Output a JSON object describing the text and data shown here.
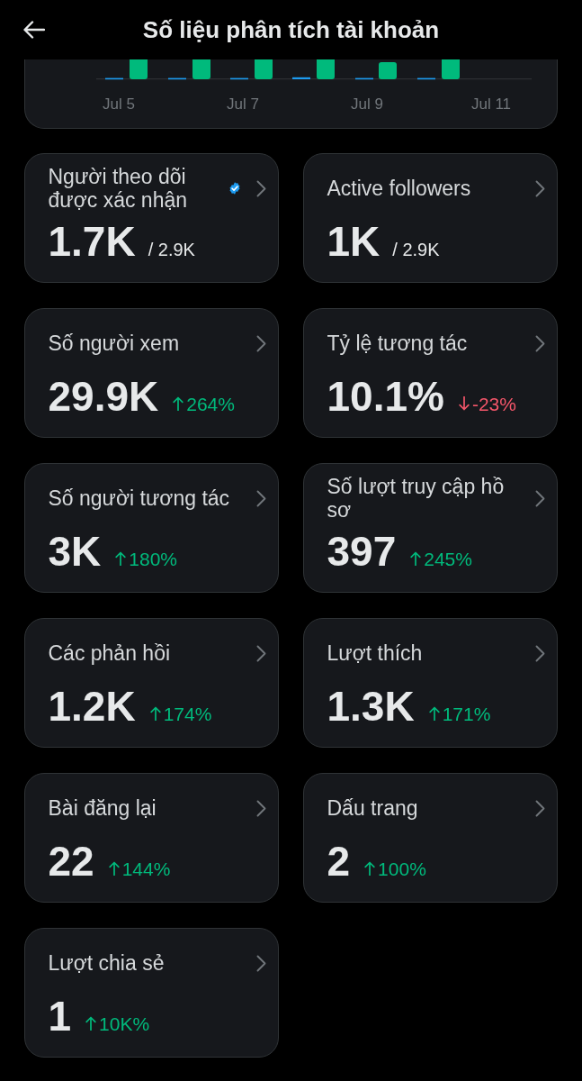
{
  "header": {
    "title": "Số liệu phân tích tài khoản"
  },
  "chart": {
    "x_labels": [
      "Jul 5",
      "Jul 7",
      "Jul 9",
      "Jul 11"
    ]
  },
  "metric_rows": [
    {
      "cards": [
        {
          "kind": "ratio",
          "label": "Người theo dõi được xác nhận",
          "verified": true,
          "value": "1.7K",
          "total": "/ 2.9K"
        },
        {
          "kind": "ratio",
          "label": "Active followers",
          "verified": false,
          "value": "1K",
          "total": "/ 2.9K"
        }
      ]
    },
    {
      "cards": [
        {
          "kind": "change",
          "label": "Số người xem",
          "verified": false,
          "value": "29.9K",
          "rising": true,
          "change": "264%"
        },
        {
          "kind": "change",
          "label": "Tỷ lệ tương tác",
          "verified": false,
          "value": "10.1%",
          "rising": false,
          "change": "-23%"
        }
      ]
    },
    {
      "cards": [
        {
          "kind": "change",
          "label": "Số người tương tác",
          "verified": false,
          "value": "3K",
          "rising": true,
          "change": "180%"
        },
        {
          "kind": "change",
          "label": "Số lượt truy cập hồ sơ",
          "verified": false,
          "value": "397",
          "rising": true,
          "change": "245%"
        }
      ]
    },
    {
      "cards": [
        {
          "kind": "change",
          "label": "Các phản hồi",
          "verified": false,
          "value": "1.2K",
          "rising": true,
          "change": "174%"
        },
        {
          "kind": "change",
          "label": "Lượt thích",
          "verified": false,
          "value": "1.3K",
          "rising": true,
          "change": "171%"
        }
      ]
    },
    {
      "cards": [
        {
          "kind": "change",
          "label": "Bài đăng lại",
          "verified": false,
          "value": "22",
          "rising": true,
          "change": "144%"
        },
        {
          "kind": "change",
          "label": "Dấu trang",
          "verified": false,
          "value": "2",
          "rising": true,
          "change": "100%"
        }
      ]
    },
    {
      "cards": [
        {
          "kind": "change",
          "label": "Lượt chia sẻ",
          "verified": false,
          "value": "1",
          "rising": true,
          "change": "10K%"
        }
      ]
    }
  ]
}
